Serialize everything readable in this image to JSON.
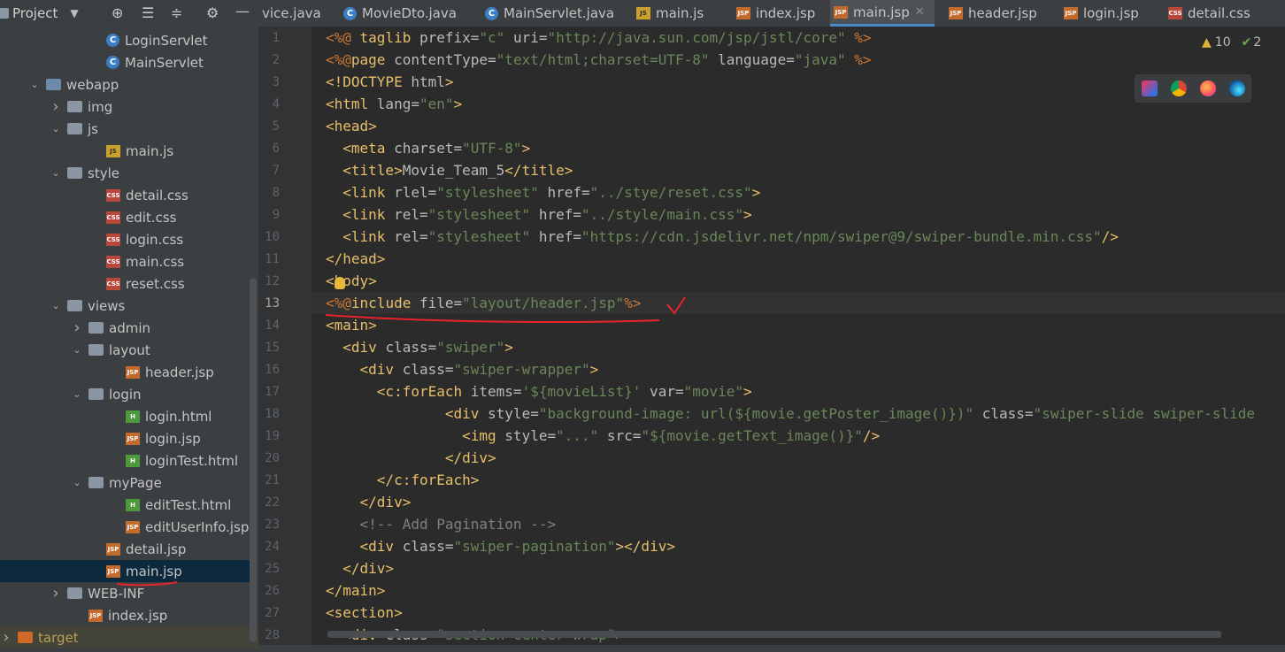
{
  "toolbar": {
    "project_label": "Project",
    "icons": [
      "crosshair-icon",
      "collapse-all-icon",
      "expand-all-icon",
      "gear-icon",
      "minimize-icon"
    ]
  },
  "tabs": [
    {
      "label": "vice.java",
      "icon": "java",
      "active": false
    },
    {
      "label": "MovieDto.java",
      "icon": "java",
      "active": false
    },
    {
      "label": "MainServlet.java",
      "icon": "java",
      "active": false
    },
    {
      "label": "main.js",
      "icon": "js",
      "active": false
    },
    {
      "label": "index.jsp",
      "icon": "jsp",
      "active": false
    },
    {
      "label": "main.jsp",
      "icon": "jsp",
      "active": true
    },
    {
      "label": "header.jsp",
      "icon": "jsp",
      "active": false
    },
    {
      "label": "login.jsp",
      "icon": "jsp",
      "active": false
    },
    {
      "label": "detail.css",
      "icon": "css",
      "active": false
    }
  ],
  "tree": [
    {
      "label": "LoginServlet",
      "depth": 5,
      "icon": "java",
      "arrow": ""
    },
    {
      "label": "MainServlet",
      "depth": 5,
      "icon": "java",
      "arrow": ""
    },
    {
      "label": "webapp",
      "depth": 2,
      "icon": "webfolder",
      "arrow": "open"
    },
    {
      "label": "img",
      "depth": 3,
      "icon": "folder",
      "arrow": "closed"
    },
    {
      "label": "js",
      "depth": 3,
      "icon": "folder",
      "arrow": "open"
    },
    {
      "label": "main.js",
      "depth": 5,
      "icon": "js",
      "arrow": ""
    },
    {
      "label": "style",
      "depth": 3,
      "icon": "folder",
      "arrow": "open"
    },
    {
      "label": "detail.css",
      "depth": 5,
      "icon": "css",
      "arrow": ""
    },
    {
      "label": "edit.css",
      "depth": 5,
      "icon": "css",
      "arrow": ""
    },
    {
      "label": "login.css",
      "depth": 5,
      "icon": "css",
      "arrow": ""
    },
    {
      "label": "main.css",
      "depth": 5,
      "icon": "css",
      "arrow": ""
    },
    {
      "label": "reset.css",
      "depth": 5,
      "icon": "css",
      "arrow": ""
    },
    {
      "label": "views",
      "depth": 3,
      "icon": "folder",
      "arrow": "open"
    },
    {
      "label": "admin",
      "depth": 4,
      "icon": "folder",
      "arrow": "closed"
    },
    {
      "label": "layout",
      "depth": 4,
      "icon": "folder",
      "arrow": "open"
    },
    {
      "label": "header.jsp",
      "depth": 6,
      "icon": "jsp",
      "arrow": ""
    },
    {
      "label": "login",
      "depth": 4,
      "icon": "folder",
      "arrow": "open"
    },
    {
      "label": "login.html",
      "depth": 6,
      "icon": "html",
      "arrow": ""
    },
    {
      "label": "login.jsp",
      "depth": 6,
      "icon": "jsp",
      "arrow": ""
    },
    {
      "label": "loginTest.html",
      "depth": 6,
      "icon": "html",
      "arrow": ""
    },
    {
      "label": "myPage",
      "depth": 4,
      "icon": "folder",
      "arrow": "open"
    },
    {
      "label": "editTest.html",
      "depth": 6,
      "icon": "html",
      "arrow": ""
    },
    {
      "label": "editUserInfo.jsp",
      "depth": 6,
      "icon": "jsp",
      "arrow": ""
    },
    {
      "label": "detail.jsp",
      "depth": 5,
      "icon": "jsp",
      "arrow": ""
    },
    {
      "label": "main.jsp",
      "depth": 5,
      "icon": "jsp",
      "arrow": "",
      "selected": true
    },
    {
      "label": "WEB-INF",
      "depth": 3,
      "icon": "folder",
      "arrow": "closed"
    },
    {
      "label": "index.jsp",
      "depth": 4,
      "icon": "jsp",
      "arrow": ""
    },
    {
      "label": "target",
      "depth": 0,
      "icon": "target",
      "arrow": "closed",
      "highlight": true
    }
  ],
  "inspections": {
    "warnings": "10",
    "ok": "2"
  },
  "browsers": [
    "intellij-icon",
    "chrome-icon",
    "firefox-icon",
    "edge-icon"
  ],
  "code": [
    [
      [
        "kw",
        "<%@ "
      ],
      [
        "tag",
        "taglib "
      ],
      [
        "attr",
        "prefix="
      ],
      [
        "str",
        "\"c\""
      ],
      [
        "attr",
        " uri="
      ],
      [
        "str",
        "\"http://java.sun.com/jsp/jstl/core\""
      ],
      [
        "kw",
        " %>"
      ]
    ],
    [
      [
        "kw",
        "<%@"
      ],
      [
        "tag",
        "page "
      ],
      [
        "attr",
        "contentType="
      ],
      [
        "str",
        "\"text/html;charset=UTF-8\""
      ],
      [
        "attr",
        " language="
      ],
      [
        "str",
        "\"java\""
      ],
      [
        "kw",
        " %>"
      ]
    ],
    [
      [
        "tag",
        "<!DOCTYPE "
      ],
      [
        "attr",
        "html"
      ],
      [
        "tag",
        ">"
      ]
    ],
    [
      [
        "tag",
        "<html "
      ],
      [
        "attr",
        "lang="
      ],
      [
        "str",
        "\"en\""
      ],
      [
        "tag",
        ">"
      ]
    ],
    [
      [
        "tag",
        "<head>"
      ]
    ],
    [
      [
        "attr",
        "  "
      ],
      [
        "tag",
        "<meta "
      ],
      [
        "attr",
        "charset="
      ],
      [
        "str",
        "\"UTF-8\""
      ],
      [
        "tag",
        ">"
      ]
    ],
    [
      [
        "attr",
        "  "
      ],
      [
        "tag",
        "<title>"
      ],
      [
        "attr",
        "Movie_Team_5"
      ],
      [
        "tag",
        "</title>"
      ]
    ],
    [
      [
        "attr",
        "  "
      ],
      [
        "tag",
        "<link "
      ],
      [
        "attr",
        "rlel="
      ],
      [
        "str",
        "\"stylesheet\""
      ],
      [
        "attr",
        " href="
      ],
      [
        "str",
        "\"../stye/reset.css\""
      ],
      [
        "tag",
        ">"
      ]
    ],
    [
      [
        "attr",
        "  "
      ],
      [
        "tag",
        "<link "
      ],
      [
        "attr",
        "rel="
      ],
      [
        "str",
        "\"stylesheet\""
      ],
      [
        "attr",
        " href="
      ],
      [
        "str",
        "\"../style/main.css\""
      ],
      [
        "tag",
        ">"
      ]
    ],
    [
      [
        "attr",
        "  "
      ],
      [
        "tag",
        "<link "
      ],
      [
        "attr",
        "rel="
      ],
      [
        "str",
        "\"stylesheet\""
      ],
      [
        "attr",
        " href="
      ],
      [
        "str",
        "\"https://cdn.jsdelivr.net/npm/swiper@9/swiper-bundle.min.css\""
      ],
      [
        "tag",
        "/>"
      ]
    ],
    [
      [
        "tag",
        "</head>"
      ]
    ],
    [
      [
        "tag",
        "<body>"
      ]
    ],
    [
      [
        "kw",
        "<%@"
      ],
      [
        "tag",
        "include "
      ],
      [
        "attr",
        "file="
      ],
      [
        "str",
        "\"layout/header.jsp\""
      ],
      [
        "kw",
        "%>"
      ]
    ],
    [
      [
        "tag",
        "<main>"
      ]
    ],
    [
      [
        "attr",
        "  "
      ],
      [
        "tag",
        "<div "
      ],
      [
        "attr",
        "class="
      ],
      [
        "str",
        "\"swiper\""
      ],
      [
        "tag",
        ">"
      ]
    ],
    [
      [
        "attr",
        "    "
      ],
      [
        "tag",
        "<div "
      ],
      [
        "attr",
        "class="
      ],
      [
        "str",
        "\"swiper-wrapper\""
      ],
      [
        "tag",
        ">"
      ]
    ],
    [
      [
        "attr",
        "      "
      ],
      [
        "tag",
        "<c:forEach "
      ],
      [
        "attr",
        "items="
      ],
      [
        "str",
        "'${movieList}'"
      ],
      [
        "attr",
        " var="
      ],
      [
        "str",
        "\"movie\""
      ],
      [
        "tag",
        ">"
      ]
    ],
    [
      [
        "attr",
        "              "
      ],
      [
        "tag",
        "<div "
      ],
      [
        "attr",
        "style="
      ],
      [
        "str",
        "\"background-image: url(${movie.getPoster_image()})\""
      ],
      [
        "attr",
        " class="
      ],
      [
        "str",
        "\"swiper-slide swiper-slide"
      ]
    ],
    [
      [
        "attr",
        "                "
      ],
      [
        "tag",
        "<img "
      ],
      [
        "attr",
        "style="
      ],
      [
        "str",
        "\"...\""
      ],
      [
        "attr",
        " src="
      ],
      [
        "str",
        "\"${movie.getText_image()}\""
      ],
      [
        "tag",
        "/>"
      ]
    ],
    [
      [
        "attr",
        "              "
      ],
      [
        "tag",
        "</div>"
      ]
    ],
    [
      [
        "attr",
        "      "
      ],
      [
        "tag",
        "</c:forEach>"
      ]
    ],
    [
      [
        "attr",
        "    "
      ],
      [
        "tag",
        "</div>"
      ]
    ],
    [
      [
        "attr",
        "    "
      ],
      [
        "cmt",
        "<!-- Add Pagination -->"
      ]
    ],
    [
      [
        "attr",
        "    "
      ],
      [
        "tag",
        "<div "
      ],
      [
        "attr",
        "class="
      ],
      [
        "str",
        "\"swiper-pagination\""
      ],
      [
        "tag",
        "></div>"
      ]
    ],
    [
      [
        "attr",
        "  "
      ],
      [
        "tag",
        "</div>"
      ]
    ],
    [
      [
        "tag",
        "</main>"
      ]
    ],
    [
      [
        "tag",
        "<section>"
      ]
    ],
    [
      [
        "attr",
        "  "
      ],
      [
        "tag",
        "<div "
      ],
      [
        "attr",
        "class="
      ],
      [
        "str",
        "\"section center wrap\""
      ],
      [
        "tag",
        ">"
      ]
    ]
  ],
  "line_numbers": [
    "1",
    "2",
    "3",
    "4",
    "5",
    "6",
    "7",
    "8",
    "9",
    "10",
    "11",
    "12",
    "13",
    "14",
    "15",
    "16",
    "17",
    "18",
    "19",
    "20",
    "21",
    "22",
    "23",
    "24",
    "25",
    "26",
    "27",
    "28"
  ],
  "colors": {
    "accent": "#4a88c7",
    "annotation": "#e8242b",
    "selection": "#0d293e"
  }
}
